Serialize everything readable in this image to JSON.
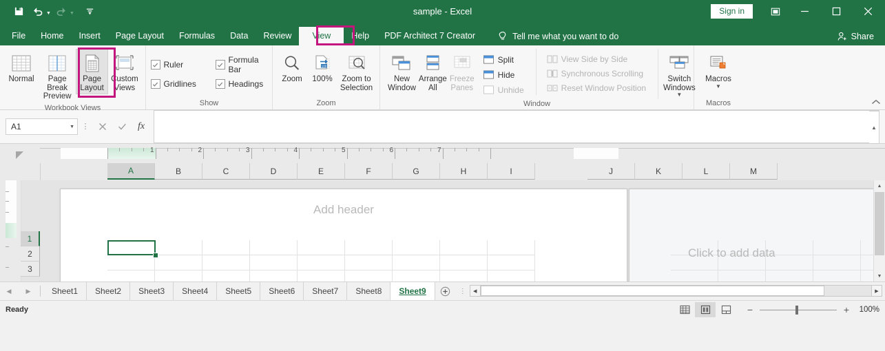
{
  "window": {
    "title": "sample  -  Excel",
    "signin_label": "Sign in",
    "ribbon_display_icon": "ribbon-display-options-icon",
    "minimize_icon": "minimize-icon",
    "maximize_icon": "maximize-icon",
    "close_icon": "close-icon"
  },
  "quick_access": {
    "save_icon": "save-icon",
    "undo_icon": "undo-icon",
    "redo_icon": "redo-icon",
    "customize_icon": "customize-quick-access-toolbar-icon"
  },
  "tabs": [
    {
      "label": "File",
      "active": false
    },
    {
      "label": "Home",
      "active": false
    },
    {
      "label": "Insert",
      "active": false
    },
    {
      "label": "Page Layout",
      "active": false
    },
    {
      "label": "Formulas",
      "active": false
    },
    {
      "label": "Data",
      "active": false
    },
    {
      "label": "Review",
      "active": false
    },
    {
      "label": "View",
      "active": true
    },
    {
      "label": "Help",
      "active": false
    },
    {
      "label": "PDF Architect 7 Creator",
      "active": false
    }
  ],
  "tell_me": {
    "label": "Tell me what you want to do",
    "icon": "lightbulb-icon"
  },
  "share": {
    "label": "Share",
    "icon": "share-person-icon"
  },
  "highlight_color": "#c2167e",
  "accent_color": "#217346",
  "ribbon": {
    "groups": [
      {
        "name": "Workbook Views",
        "label": "Workbook Views",
        "buttons": [
          {
            "label": "Normal",
            "icon": "normal-view-icon",
            "state": "normal"
          },
          {
            "label": "Page Break Preview",
            "icon": "page-break-preview-icon",
            "state": "normal"
          },
          {
            "label": "Page Layout",
            "icon": "page-layout-icon",
            "state": "selected"
          },
          {
            "label": "Custom Views",
            "icon": "custom-views-icon",
            "state": "normal"
          }
        ]
      },
      {
        "name": "Show",
        "label": "Show",
        "checkboxes": [
          {
            "label": "Ruler",
            "checked": true
          },
          {
            "label": "Formula Bar",
            "checked": true
          },
          {
            "label": "Gridlines",
            "checked": true
          },
          {
            "label": "Headings",
            "checked": true
          }
        ]
      },
      {
        "name": "Zoom",
        "label": "Zoom",
        "buttons": [
          {
            "label": "Zoom",
            "icon": "magnifier-icon",
            "state": "normal"
          },
          {
            "label": "100%",
            "icon": "zoom-100-icon",
            "state": "normal"
          },
          {
            "label": "Zoom to Selection",
            "icon": "zoom-to-selection-icon",
            "state": "normal"
          }
        ]
      },
      {
        "name": "Window",
        "label": "Window",
        "buttons": [
          {
            "label": "New Window",
            "icon": "new-window-icon",
            "state": "normal"
          },
          {
            "label": "Arrange All",
            "icon": "arrange-all-icon",
            "state": "normal"
          },
          {
            "label": "Freeze Panes",
            "icon": "freeze-panes-icon",
            "state": "disabled",
            "dropdown": true
          }
        ],
        "small_buttons_left": [
          {
            "label": "Split",
            "icon": "split-icon",
            "state": "normal"
          },
          {
            "label": "Hide",
            "icon": "hide-window-icon",
            "state": "normal"
          },
          {
            "label": "Unhide",
            "icon": "unhide-window-icon",
            "state": "disabled"
          }
        ],
        "small_buttons_right": [
          {
            "label": "View Side by Side",
            "icon": "view-side-by-side-icon",
            "state": "disabled"
          },
          {
            "label": "Synchronous Scrolling",
            "icon": "synchronous-scrolling-icon",
            "state": "disabled"
          },
          {
            "label": "Reset Window Position",
            "icon": "reset-window-position-icon",
            "state": "disabled"
          }
        ],
        "switch_windows": {
          "label": "Switch Windows",
          "icon": "switch-windows-icon",
          "dropdown": true
        }
      },
      {
        "name": "Macros",
        "label": "Macros",
        "buttons": [
          {
            "label": "Macros",
            "icon": "macros-icon",
            "state": "normal",
            "dropdown": true
          }
        ]
      }
    ],
    "collapse_icon": "collapse-ribbon-icon"
  },
  "formula_bar": {
    "name_box_value": "A1",
    "name_box_caret": "chevron-down-icon",
    "cancel_icon": "cancel-entry-icon",
    "enter_icon": "confirm-entry-icon",
    "fx_label": "fx",
    "formula_value": "",
    "expand_icon": "expand-formula-bar-icon"
  },
  "sheet_view": {
    "select_all_icon": "select-all-corner-icon",
    "columns": [
      "A",
      "B",
      "C",
      "D",
      "E",
      "F",
      "G",
      "H",
      "I",
      "J",
      "K",
      "L",
      "M"
    ],
    "selected_column": "A",
    "rows": [
      "1",
      "2",
      "3"
    ],
    "selected_row": "1",
    "ruler_numbers": [
      "1",
      "2",
      "3",
      "4",
      "5",
      "6",
      "7"
    ],
    "header_placeholder": "Add header",
    "add_data_placeholder": "Click to add data",
    "active_cell": "A1",
    "scroll_up_icon": "scroll-up-icon",
    "scroll_down_icon": "scroll-down-icon"
  },
  "sheet_tabs": {
    "first_icon": "first-sheet-icon",
    "prev_icon": "previous-sheet-icon",
    "tabs": [
      {
        "label": "Sheet1",
        "active": false
      },
      {
        "label": "Sheet2",
        "active": false
      },
      {
        "label": "Sheet3",
        "active": false
      },
      {
        "label": "Sheet4",
        "active": false
      },
      {
        "label": "Sheet5",
        "active": false
      },
      {
        "label": "Sheet6",
        "active": false
      },
      {
        "label": "Sheet7",
        "active": false
      },
      {
        "label": "Sheet8",
        "active": false
      },
      {
        "label": "Sheet9",
        "active": true
      }
    ],
    "add_sheet_icon": "add-sheet-icon",
    "scroll_left_icon": "scroll-left-icon",
    "scroll_right_icon": "scroll-right-icon"
  },
  "status_bar": {
    "status_text": "Ready",
    "view_buttons": [
      {
        "name": "normal-view",
        "icon": "normal-view-small-icon",
        "active": false
      },
      {
        "name": "page-layout-view",
        "icon": "page-layout-view-small-icon",
        "active": true
      },
      {
        "name": "page-break-preview-view",
        "icon": "page-break-view-small-icon",
        "active": false
      }
    ],
    "zoom_out_label": "−",
    "zoom_in_label": "+",
    "zoom_level": "100%"
  }
}
